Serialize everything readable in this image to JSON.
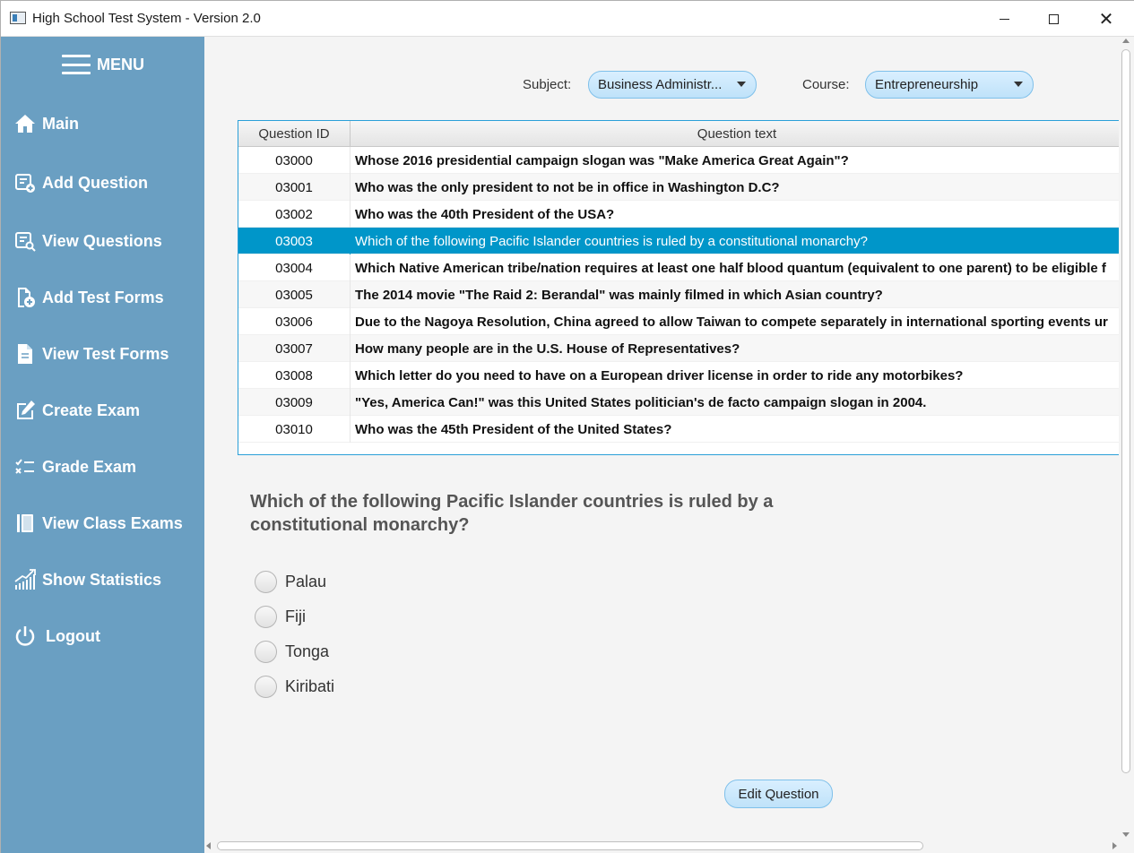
{
  "window": {
    "title": "High School Test System - Version 2.0",
    "controls": [
      "minimize-icon",
      "maximize-icon",
      "close-icon"
    ]
  },
  "sidebar": {
    "menu_label": "MENU",
    "bg_color": "#6a9fc2",
    "items": [
      {
        "label": "Main",
        "icon": "home-icon"
      },
      {
        "label": "Add Question",
        "icon": "add-list-icon"
      },
      {
        "label": "View Questions",
        "icon": "search-list-icon"
      },
      {
        "label": "Add Test Forms",
        "icon": "add-document-icon"
      },
      {
        "label": "View Test Forms",
        "icon": "document-icon"
      },
      {
        "label": "Create Exam",
        "icon": "edit-icon"
      },
      {
        "label": "Grade Exam",
        "icon": "checklist-icon"
      },
      {
        "label": "View Class Exams",
        "icon": "book-icon"
      },
      {
        "label": "Show Statistics",
        "icon": "chart-icon"
      },
      {
        "label": "Logout",
        "icon": "power-icon"
      }
    ]
  },
  "filters": {
    "subject_label": "Subject:",
    "subject_value": "Business Administr...",
    "course_label": "Course:",
    "course_value": "Entrepreneurship"
  },
  "table": {
    "columns": [
      "Question ID",
      "Question text"
    ],
    "selected_index": 3,
    "selection_color": "#0096c9",
    "rows": [
      {
        "id": "03000",
        "text": "Whose 2016 presidential campaign slogan was \"Make America Great Again\"?"
      },
      {
        "id": "03001",
        "text": "Who was the only president to not be in office in Washington D.C?"
      },
      {
        "id": "03002",
        "text": "Who was the 40th President of the USA?"
      },
      {
        "id": "03003",
        "text": "Which of the following Pacific Islander countries is ruled by a constitutional monarchy?"
      },
      {
        "id": "03004",
        "text": "Which Native American tribe/nation requires at least one half blood quantum (equivalent to one parent) to be eligible f"
      },
      {
        "id": "03005",
        "text": "The 2014 movie \"The Raid 2: Berandal\" was mainly filmed in which Asian country?"
      },
      {
        "id": "03006",
        "text": "Due to the Nagoya Resolution, China agreed to allow Taiwan to compete separately in international sporting events ur"
      },
      {
        "id": "03007",
        "text": "How many people are in the U.S. House of Representatives?"
      },
      {
        "id": "03008",
        "text": "Which letter do you need to have on a European driver license in order to ride any motorbikes?"
      },
      {
        "id": "03009",
        "text": "\"Yes, America Can!\" was this United States politician's de facto campaign slogan in 2004."
      },
      {
        "id": "03010",
        "text": "Who was the 45th President of the United States?"
      }
    ]
  },
  "question": {
    "text": "Which of the following Pacific Islander countries is ruled by a constitutional monarchy?",
    "choices": [
      "Palau",
      "Fiji",
      "Tonga",
      "Kiribati"
    ]
  },
  "actions": {
    "edit_label": "Edit Question"
  }
}
